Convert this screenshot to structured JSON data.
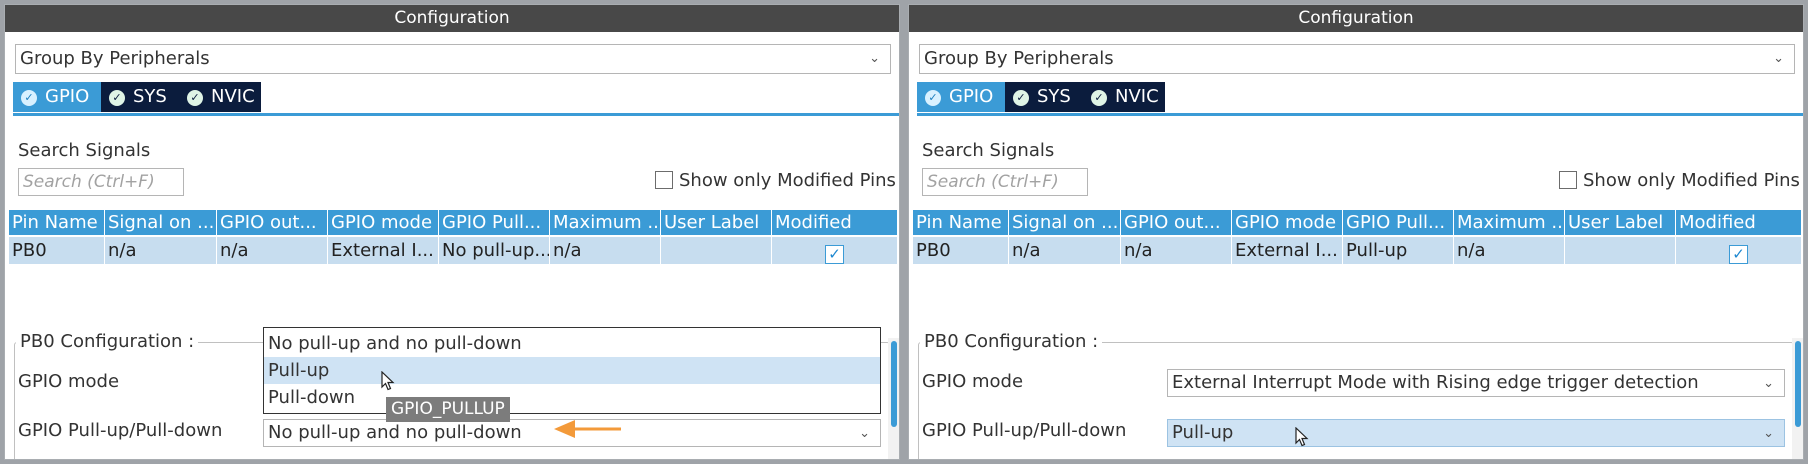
{
  "panels": [
    {
      "title": "Configuration",
      "group_by": "Group By Peripherals",
      "tabs": [
        {
          "label": "GPIO",
          "active": true
        },
        {
          "label": "SYS",
          "active": false
        },
        {
          "label": "NVIC",
          "active": false
        }
      ],
      "search_label": "Search Signals",
      "search_placeholder": "Search (Ctrl+F)",
      "show_modified_label": "Show only Modified Pins",
      "columns": [
        "Pin Name",
        "Signal on ...",
        "GPIO out...",
        "GPIO mode",
        "GPIO Pull...",
        "Maximum ...",
        "User Label",
        "Modified"
      ],
      "row": {
        "pin": "PB0",
        "signal": "n/a",
        "gpio_out": "n/a",
        "gpio_mode": "External I...",
        "pull": "No pull-up...",
        "max": "n/a",
        "user_label": "",
        "modified": true
      },
      "config_legend": "PB0 Configuration :",
      "gpio_mode_label": "GPIO mode",
      "gpio_mode_value": "",
      "pull_label": "GPIO Pull-up/Pull-down",
      "pull_value": "No pull-up and no pull-down",
      "dropdown_options": [
        "No pull-up and no pull-down",
        "Pull-up",
        "Pull-down"
      ],
      "dropdown_hovered": 1,
      "tooltip": "GPIO_PULLUP"
    },
    {
      "title": "Configuration",
      "group_by": "Group By Peripherals",
      "tabs": [
        {
          "label": "GPIO",
          "active": true
        },
        {
          "label": "SYS",
          "active": false
        },
        {
          "label": "NVIC",
          "active": false
        }
      ],
      "search_label": "Search Signals",
      "search_placeholder": "Search (Ctrl+F)",
      "show_modified_label": "Show only Modified Pins",
      "columns": [
        "Pin Name",
        "Signal on ...",
        "GPIO out...",
        "GPIO mode",
        "GPIO Pull...",
        "Maximum ...",
        "User Label",
        "Modified"
      ],
      "row": {
        "pin": "PB0",
        "signal": "n/a",
        "gpio_out": "n/a",
        "gpio_mode": "External I...",
        "pull": "Pull-up",
        "max": "n/a",
        "user_label": "",
        "modified": true
      },
      "config_legend": "PB0 Configuration :",
      "gpio_mode_label": "GPIO mode",
      "gpio_mode_value": "External Interrupt Mode with Rising edge trigger detection",
      "pull_label": "GPIO Pull-up/Pull-down",
      "pull_value": "Pull-up"
    }
  ],
  "colors": {
    "title_bar": "#484848",
    "accent": "#3b9bd6",
    "tab_inactive": "#0b1c3d",
    "row_selected": "#c7ddef",
    "annotation_arrow": "#f39a3a"
  },
  "icons": {
    "tab_check": "check-circle-icon",
    "combo_chevron": "chevron-down-icon",
    "header_sort": "sort-up-icon"
  }
}
